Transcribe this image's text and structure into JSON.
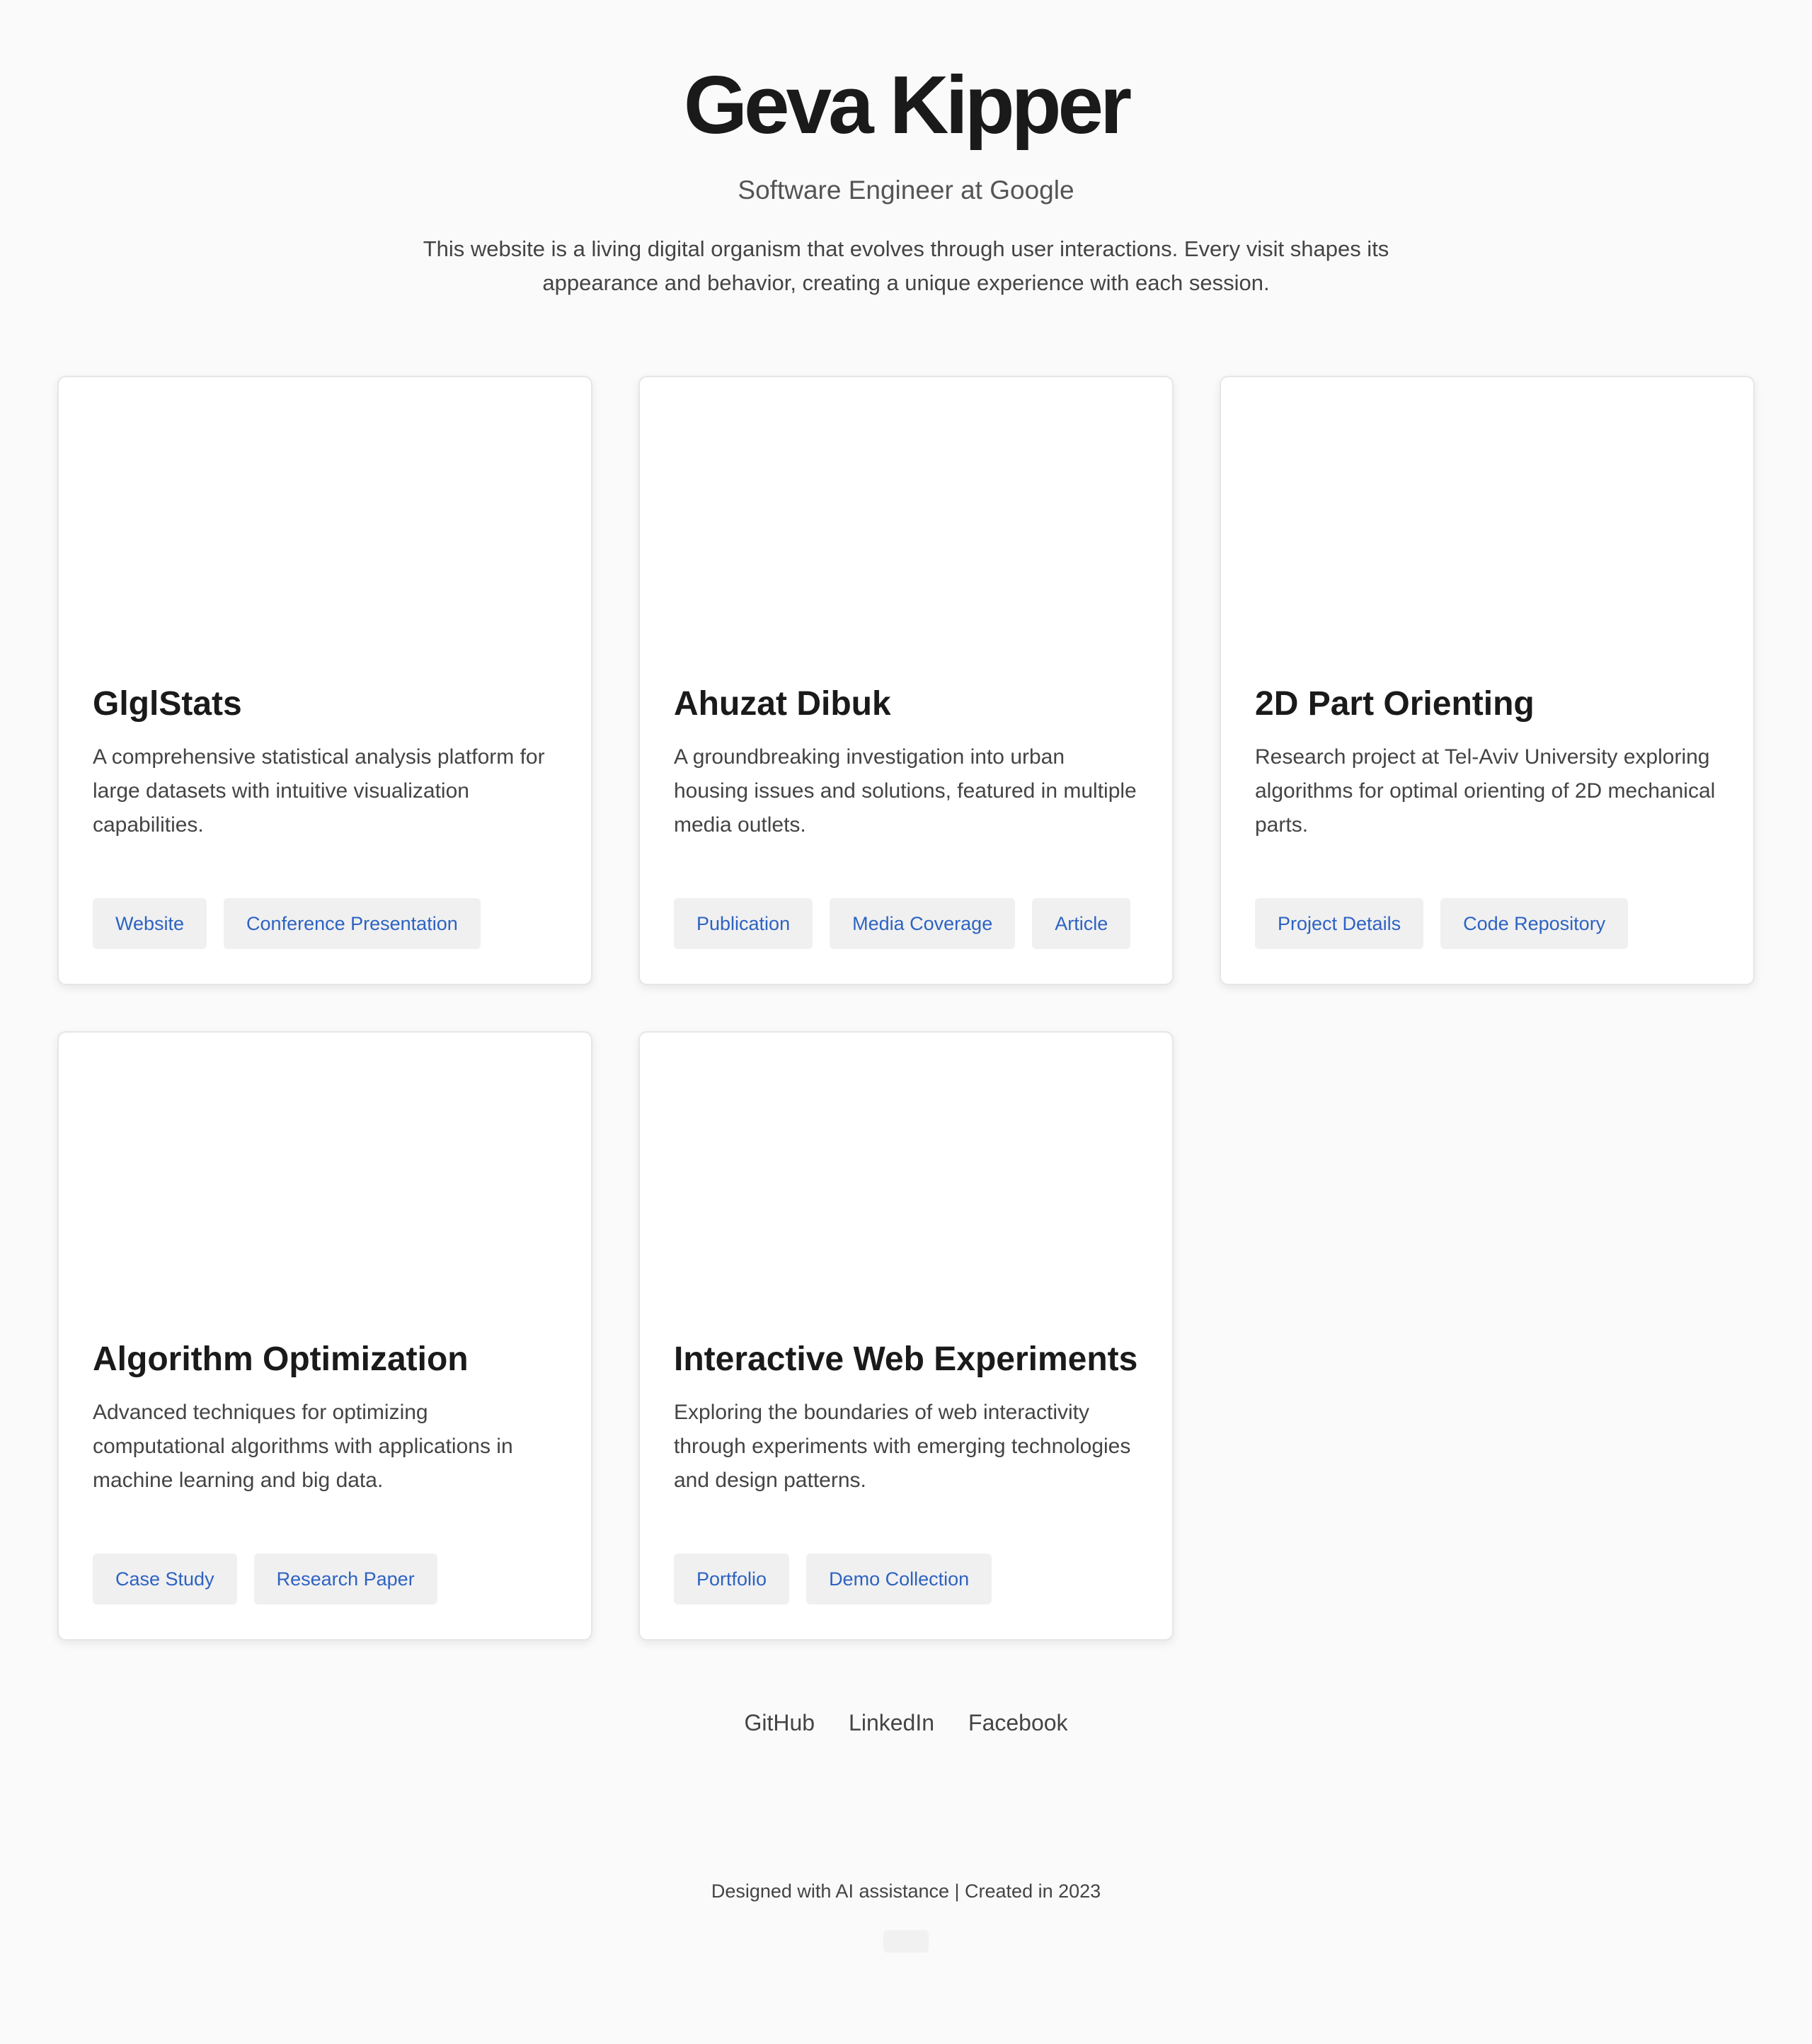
{
  "header": {
    "title": "Geva Kipper",
    "subtitle": "Software Engineer at Google",
    "intro": "This website is a living digital organism that evolves through user interactions. Every visit shapes its appearance and behavior, creating a unique experience with each session."
  },
  "projects": [
    {
      "title": "GlglStats",
      "description": "A comprehensive statistical analysis platform for large datasets with intuitive visualization capabilities.",
      "links": [
        "Website",
        "Conference Presentation"
      ]
    },
    {
      "title": "Ahuzat Dibuk",
      "description": "A groundbreaking investigation into urban housing issues and solutions, featured in multiple media outlets.",
      "links": [
        "Publication",
        "Media Coverage",
        "Article"
      ]
    },
    {
      "title": "2D Part Orienting",
      "description": "Research project at Tel-Aviv University exploring algorithms for optimal orienting of 2D mechanical parts.",
      "links": [
        "Project Details",
        "Code Repository"
      ]
    },
    {
      "title": "Algorithm Optimization",
      "description": "Advanced techniques for optimizing computational algorithms with applications in machine learning and big data.",
      "links": [
        "Case Study",
        "Research Paper"
      ]
    },
    {
      "title": "Interactive Web Experiments",
      "description": "Exploring the boundaries of web interactivity through experiments with emerging technologies and design patterns.",
      "links": [
        "Portfolio",
        "Demo Collection"
      ]
    }
  ],
  "social": [
    "GitHub",
    "LinkedIn",
    "Facebook"
  ],
  "footer": {
    "text": "Designed with AI assistance | Created in 2023"
  },
  "colors": {
    "background": "#fafafa",
    "link": "#2d63c1",
    "link_bg": "#f0f0f1",
    "text": "#1a1a1a",
    "muted": "#444444"
  }
}
